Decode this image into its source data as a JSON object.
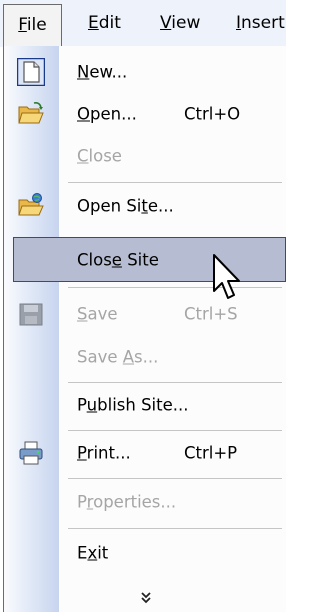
{
  "menubar": {
    "file": {
      "pre": "",
      "ul": "F",
      "post": "ile"
    },
    "edit": {
      "pre": "",
      "ul": "E",
      "post": "dit"
    },
    "view": {
      "pre": "",
      "ul": "V",
      "post": "iew"
    },
    "insert": {
      "pre": "",
      "ul": "I",
      "post": "nsert"
    }
  },
  "menu": {
    "new": {
      "pre": "",
      "ul": "N",
      "post": "ew..."
    },
    "open": {
      "pre": "",
      "ul": "O",
      "post": "pen...",
      "shortcut": "Ctrl+O"
    },
    "close": {
      "pre": "",
      "ul": "C",
      "post": "lose"
    },
    "open_site": {
      "pre": "Open Si",
      "ul": "t",
      "post": "e..."
    },
    "close_site": {
      "pre": "Clos",
      "ul": "e",
      "post": " Site"
    },
    "save": {
      "pre": "",
      "ul": "S",
      "post": "ave",
      "shortcut": "Ctrl+S"
    },
    "save_as": {
      "pre": "Save ",
      "ul": "A",
      "post": "s..."
    },
    "publish": {
      "pre": "P",
      "ul": "u",
      "post": "blish Site..."
    },
    "print": {
      "pre": "",
      "ul": "P",
      "post": "rint...",
      "shortcut": "Ctrl+P"
    },
    "properties": {
      "pre": "P",
      "ul": "r",
      "post": "operties..."
    },
    "exit": {
      "pre": "E",
      "ul": "x",
      "post": "it"
    },
    "more_icon": "double-chevron-down-icon"
  },
  "colors": {
    "highlight_bg": "#b6bdd2",
    "highlight_border": "#3a4a7a",
    "disabled_text": "#a5a5a5",
    "menubar_bg": "#eef2fb"
  }
}
